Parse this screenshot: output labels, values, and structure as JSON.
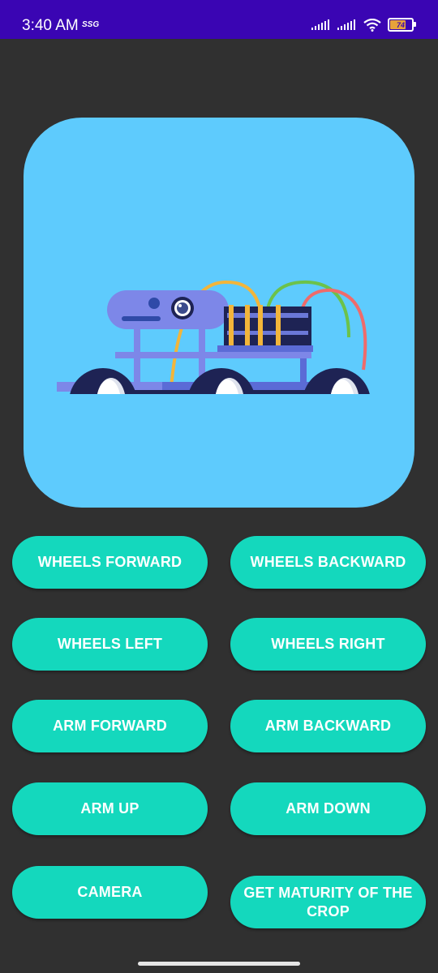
{
  "status_bar": {
    "time": "3:40 AM",
    "network_label": "SSG",
    "battery_level": "74",
    "battery_percent": 74,
    "background_color": "#3a05b3"
  },
  "hero": {
    "background_color": "#5ecbfd",
    "image_icon": "robot-car-illustration"
  },
  "buttons": {
    "wheels_forward": "WHEELS FORWARD",
    "wheels_backward": "WHEELS BACKWARD",
    "wheels_left": "WHEELS LEFT",
    "wheels_right": "WHEELS RIGHT",
    "arm_forward": "ARM FORWARD",
    "arm_backward": "ARM BACKWARD",
    "arm_up": "ARM UP",
    "arm_down": "ARM DOWN",
    "camera": "CAMERA",
    "get_maturity": "GET MATURITY OF THE CROP"
  },
  "theme": {
    "button_color": "#14d8bd",
    "page_background": "#303030"
  }
}
